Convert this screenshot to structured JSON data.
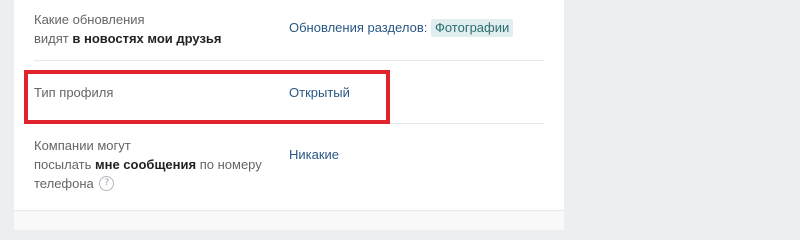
{
  "settings": {
    "news_updates": {
      "label_part1": "Какие обновления",
      "label_part2": "видят",
      "label_bold": "в новостях мои друзья",
      "value_prefix": "Обновления разделов:",
      "value_tag": "Фотографии"
    },
    "profile_type": {
      "label": "Тип профиля",
      "value": "Открытый"
    },
    "company_messages": {
      "label_part1": "Компании могут",
      "label_part2": "посылать",
      "label_bold": "мне сообщения",
      "label_part3": "по номеру",
      "label_part4": "телефона",
      "help_icon_glyph": "?",
      "value": "Никакие"
    }
  },
  "colors": {
    "highlight": "#e1232b",
    "link": "#2a5885",
    "tag_bg": "#e1eef0"
  }
}
